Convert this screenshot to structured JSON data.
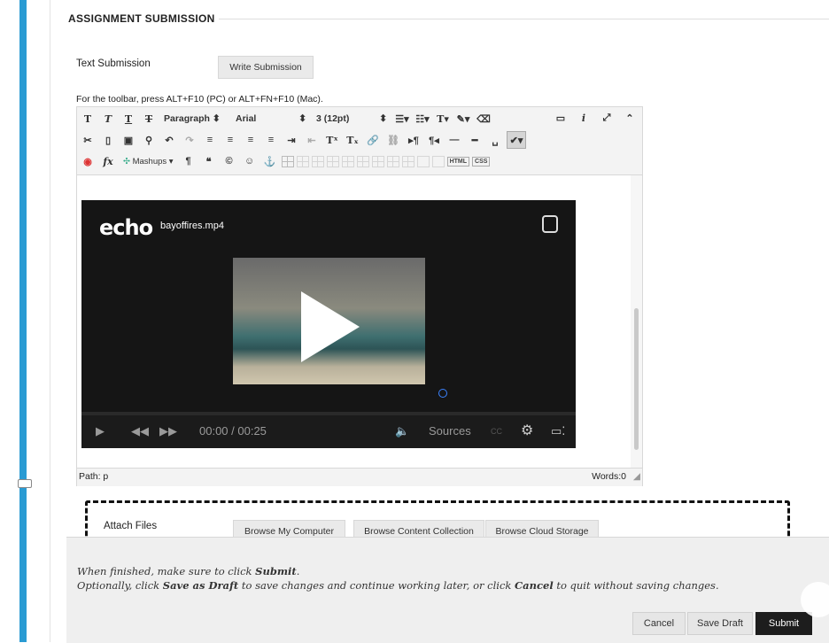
{
  "section": {
    "title": "ASSIGNMENT SUBMISSION"
  },
  "text_submission": {
    "label": "Text Submission",
    "write_button": "Write Submission"
  },
  "toolbar_hint": "For the toolbar, press ALT+F10 (PC) or ALT+FN+F10 (Mac).",
  "toolbar": {
    "paragraph": "Paragraph",
    "font": "Arial",
    "size": "3 (12pt)",
    "mashups": "Mashups",
    "html": "HTML",
    "css": "CSS"
  },
  "video": {
    "logo": "echo",
    "filename": "bayoffires.mp4",
    "time": "00:00 / 00:25",
    "sources": "Sources",
    "cc": "CC"
  },
  "statusbar": {
    "path": "Path: p",
    "words": "Words:0"
  },
  "attach": {
    "label": "Attach Files",
    "browse_computer": "Browse My Computer",
    "browse_content": "Browse Content Collection",
    "browse_cloud": "Browse Cloud Storage"
  },
  "footer": {
    "line1_a": "When finished, make sure to click ",
    "line1_b": "Submit",
    "line1_c": ".",
    "line2_a": "Optionally, click ",
    "line2_b": "Save as Draft",
    "line2_c": " to save changes and continue working later, or click ",
    "line2_d": "Cancel",
    "line2_e": " to quit without saving changes.",
    "cancel": "Cancel",
    "save_draft": "Save Draft",
    "submit": "Submit"
  },
  "colors": {
    "accent_bar": "#2a9bd3",
    "submit_bg": "#1d1d1d"
  }
}
